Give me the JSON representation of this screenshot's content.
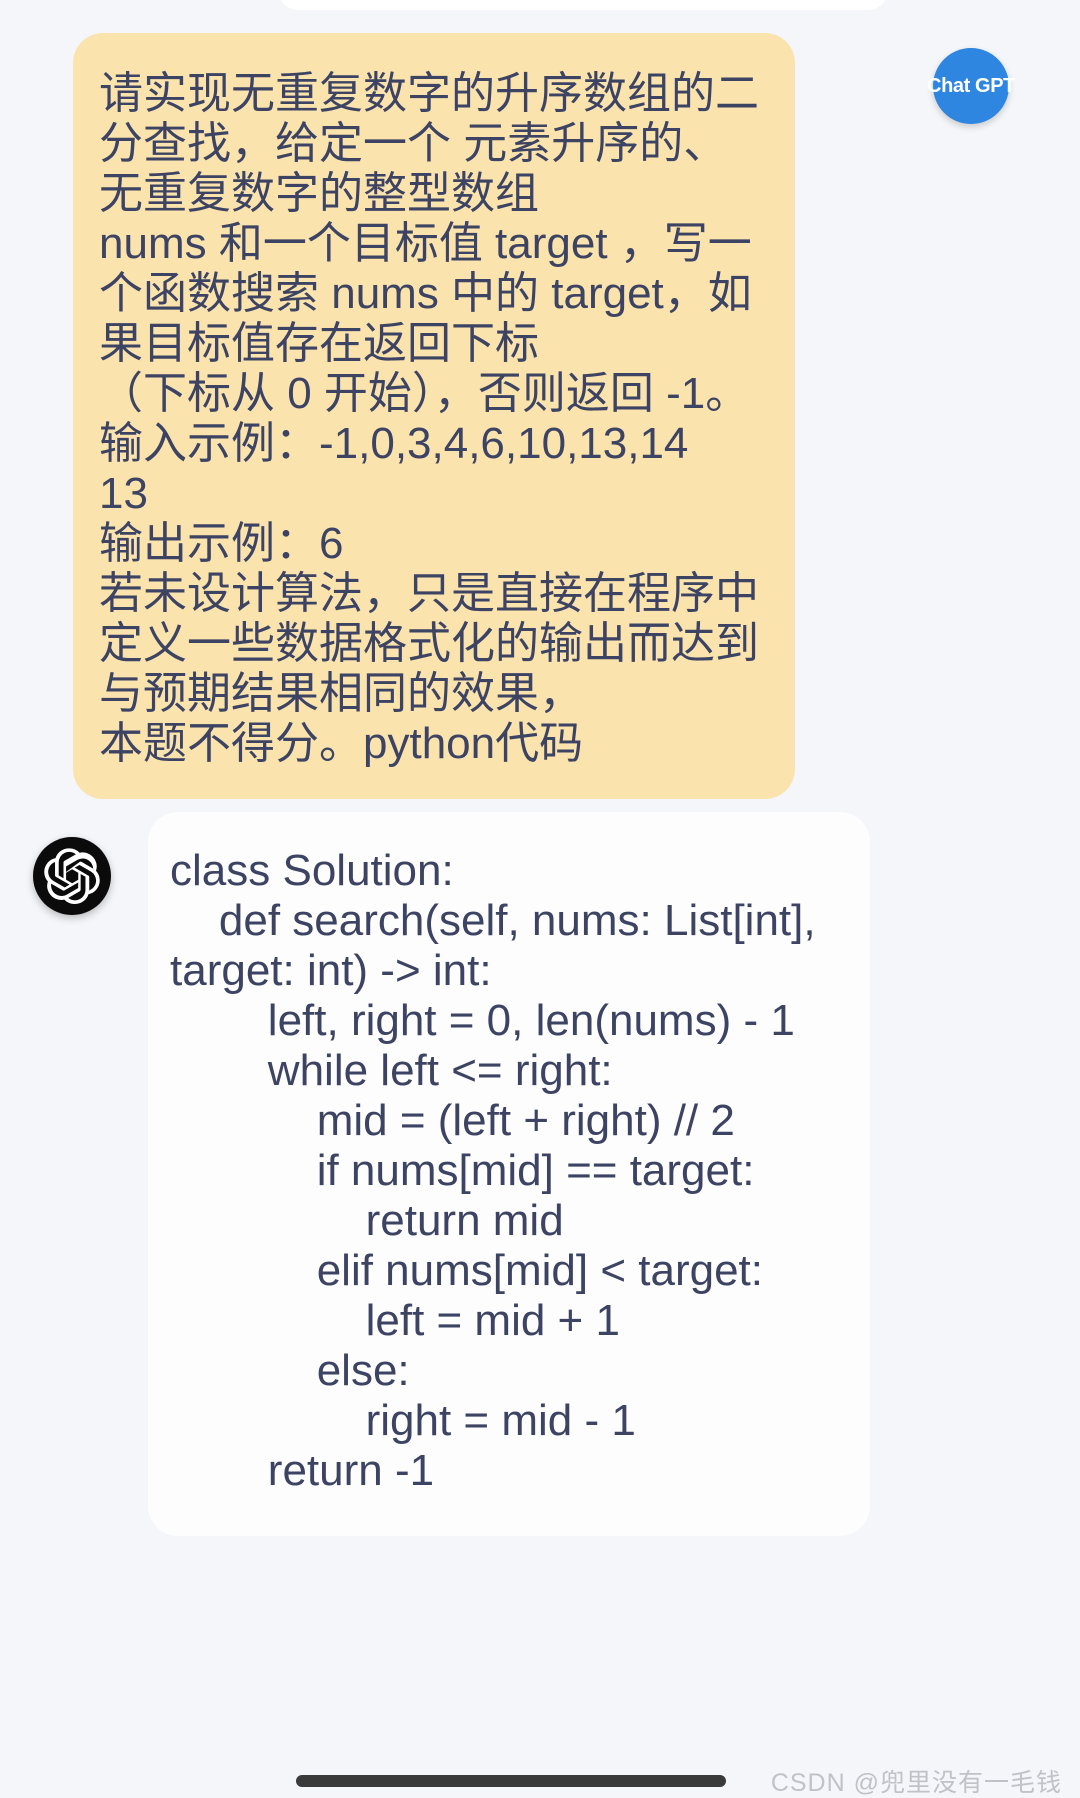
{
  "theme": {
    "page_background": "#f4f6f9",
    "user_bubble_color": "#fbe3ae",
    "bot_bubble_color": "#fdfdfd",
    "text_color": "#3d4463",
    "user_avatar_color": "#2e86e0",
    "bot_avatar_color": "#0b0b0b",
    "watermark_color": "#bfc2c7"
  },
  "conversation": {
    "user_message": {
      "avatar_label": "Chat GPT",
      "avatar_icon": "chat-gpt-circle-icon",
      "text": "请实现无重复数字的升序数组的二分查找，给定一个 元素升序的、无重复数字的整型数组\nnums 和一个目标值 target ，写一个函数搜索 nums 中的 target，如果目标值存在返回下标\n（下标从 0 开始），否则返回 -1。\n输入示例：-1,0,3,4,6,10,13,14\n13\n输出示例：6\n若未设计算法，只是直接在程序中定义一些数据格式化的输出而达到与预期结果相同的效果，\n本题不得分。python代码"
    },
    "bot_message": {
      "avatar_icon": "openai-logo-icon",
      "code": "class Solution:\n    def search(self, nums: List[int], target: int) -> int:\n        left, right = 0, len(nums) - 1\n        while left <= right:\n            mid = (left + right) // 2\n            if nums[mid] == target:\n                return mid\n            elif nums[mid] < target:\n                left = mid + 1\n            else:\n                right = mid - 1\n        return -1"
    }
  },
  "system_bar": {
    "home_indicator": "home-indicator-bar",
    "watermark": "CSDN @兜里没有一毛钱"
  }
}
